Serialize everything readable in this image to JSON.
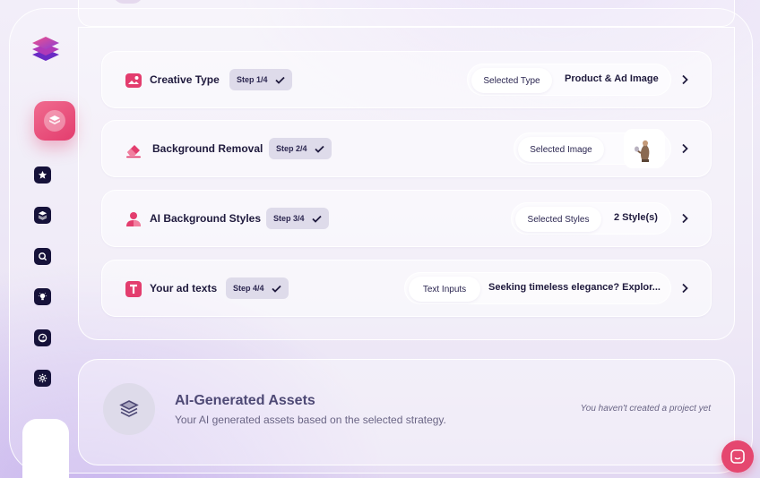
{
  "colors": {
    "accent": "#e33d6e",
    "nav_icon": "#16123a",
    "badge_bg": "#dedbea",
    "text_dark": "#1f1a3d"
  },
  "sidebar": {
    "logo_icon": "layers-logo-icon",
    "active_item_icon": "cube-icon",
    "items": [
      {
        "icon": "star-icon"
      },
      {
        "icon": "layers-icon"
      },
      {
        "icon": "search-icon"
      },
      {
        "icon": "bulb-icon"
      },
      {
        "icon": "gauge-icon"
      },
      {
        "icon": "gear-icon"
      }
    ]
  },
  "steps": [
    {
      "title": "Creative Type",
      "badge": "Step 1/4",
      "selection_label": "Selected Type",
      "selection_value": "Product & Ad Image",
      "icon": "image-icon"
    },
    {
      "title": "Background Removal",
      "badge": "Step 2/4",
      "selection_label": "Selected Image",
      "selection_value": "",
      "icon": "eraser-icon"
    },
    {
      "title": "AI Background Styles",
      "badge": "Step 3/4",
      "selection_label": "Selected Styles",
      "selection_value": "2 Style(s)",
      "icon": "user-icon"
    },
    {
      "title": "Your ad texts",
      "badge": "Step 4/4",
      "selection_label": "Text Inputs",
      "selection_value": "Seeking timeless elegance? Explor...",
      "icon": "text-icon"
    }
  ],
  "assets": {
    "title": "AI-Generated Assets",
    "subtitle": "Your AI generated assets based on the selected strategy.",
    "empty_state": "You haven't created a project yet",
    "icon": "layers-icon"
  },
  "chat": {
    "icon": "chat-icon"
  }
}
